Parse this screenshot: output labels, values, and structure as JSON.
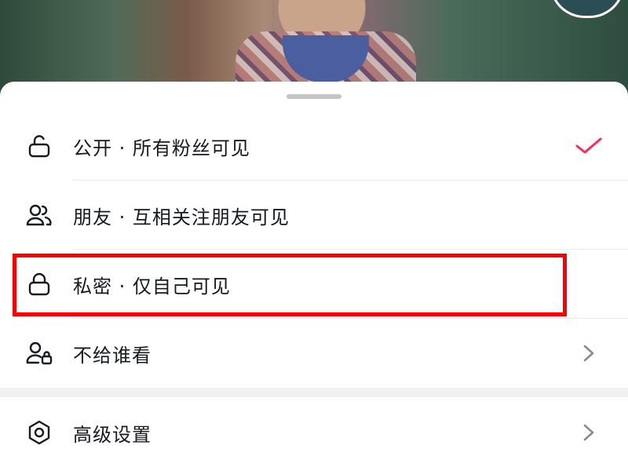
{
  "options": [
    {
      "label": "公开 · 所有粉丝可见",
      "icon": "unlock-icon",
      "selected": true
    },
    {
      "label": "朋友 · 互相关注朋友可见",
      "icon": "friends-icon"
    },
    {
      "label": "私密 · 仅自己可见",
      "icon": "lock-icon"
    },
    {
      "label": "不给谁看",
      "icon": "user-lock-icon"
    }
  ],
  "advanced": {
    "label": "高级设置",
    "icon": "hexagon-settings-icon"
  },
  "colors": {
    "accent": "#fe2c55",
    "highlight": "#ff0000"
  }
}
